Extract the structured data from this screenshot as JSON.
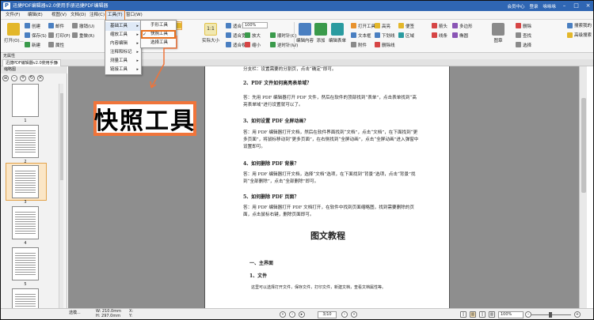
{
  "titlebar": {
    "app_icon": "P",
    "title": "迅捷PDF编辑器v2.0使用手册迅捷PDF编辑器",
    "vip": "会员中心",
    "login": "登录",
    "user": "咏咏咏"
  },
  "menus": [
    "文件(F)",
    "编辑(E)",
    "视图(V)",
    "文档(D)",
    "注释(C)",
    "表单(R)",
    "工具(T)",
    "窗口(W)"
  ],
  "ribbon": {
    "open": "打开(O)...",
    "row1": [
      "创建",
      "邮件",
      "撤销(U)"
    ],
    "row2": [
      "保存(S)",
      "打印(P)",
      "属性",
      "重做(R)"
    ],
    "row3": [
      "新建"
    ],
    "actual_size": "实际大小",
    "zoom_value": "100%",
    "fit_items": [
      "适合页面",
      "适合宽度",
      "适合视图"
    ],
    "zoom_items": [
      "放大",
      "缩小",
      "顺时针(C)",
      "逆时针(W)",
      "查找"
    ],
    "edit_tools": [
      "编辑内容",
      "添加",
      "链接",
      "编辑表单",
      "打开工具",
      "文本框",
      "附件",
      "标注",
      "注释",
      "高亮",
      "下划线",
      "删除线",
      "便签",
      "区域",
      "箭头",
      "多边形",
      "线条",
      "椭圆",
      "铅笔",
      "测量",
      "图章",
      "删除",
      "查找",
      "选择"
    ],
    "search_label": "搜索我的",
    "ocr_label": "高级搜索"
  },
  "tools_menu": {
    "items": [
      "基础工具",
      "缩放工具",
      "内容编辑",
      "注释和标记",
      "测量工具",
      "链接工具"
    ],
    "submenu": [
      "手形工具",
      "快照工具",
      "选择工具"
    ],
    "checked": "快照工具"
  },
  "annotation": {
    "label": "快照工具",
    "color": "#f0743a"
  },
  "tabrow": {
    "label": "无属性"
  },
  "doc_tab": {
    "name": "迅捷PDF编辑器v2.0使用手册",
    "close": "×"
  },
  "left_panel": {
    "title": "缩略图",
    "page_numbers": [
      "1",
      "2",
      "3",
      "4",
      "5",
      "6"
    ],
    "selected": "3"
  },
  "document": {
    "lines": [
      {
        "kind": "p",
        "text": "分支栏：设置需要的分割页，点击“确定”即可。"
      },
      {
        "kind": "h",
        "text": "2、PDF 文件如何高亮表单域？"
      },
      {
        "kind": "p",
        "text": "答：先用 PDF 编辑器打开 PDF 文件，然后在软件的顶部找到“表单”，点击表单找到“高亮表单域”进行设置就可以了。"
      },
      {
        "kind": "h",
        "text": "3、如何设置 PDF 全屏动画？"
      },
      {
        "kind": "p",
        "text": "答：用 PDF 编辑器打开文档，然后在软件界面找到“文档”，点击“文档”，在下面找到“更多页面”，将鼠标移动到“更多页面”，在右侧找到“全屏动画”，点击“全屏动画”进入弹窗中设置即可。"
      },
      {
        "kind": "h",
        "text": "4、如何删除 PDF 背景？"
      },
      {
        "kind": "p",
        "text": "答：用 PDF 编辑器打开文档，选择“文档”选项，在下面找到“背景”选项，点击“背景”找到“全部删除”，点击“全部删除”即可。"
      },
      {
        "kind": "h",
        "text": "5、如何删除 PDF 页面？"
      },
      {
        "kind": "p",
        "text": "答：用 PDF 编辑器打开 PDF 文档打开，在软件中找到页面缩略图，找到需要删除的页面，点击鼠标右键，删除页面即可。"
      }
    ],
    "big_title": "图文教程",
    "section1": "一、主界面",
    "section1_sub": "1、文件",
    "section1_text": "这里可以选择打开文件，保存文件，打印文件，新建文档，查看文档属性等。"
  },
  "statusbar": {
    "select": "选模...",
    "width": "W: 210.0mm",
    "height": "H: 297.0mm",
    "x_label": "X:",
    "y_label": "Y:",
    "page_current": "3",
    "page_total": "/10",
    "zoom": "100%"
  },
  "colors": {
    "titlebar": "#2f66b3",
    "highlight": "#e8711f",
    "canvas": "#8e8e8e"
  }
}
